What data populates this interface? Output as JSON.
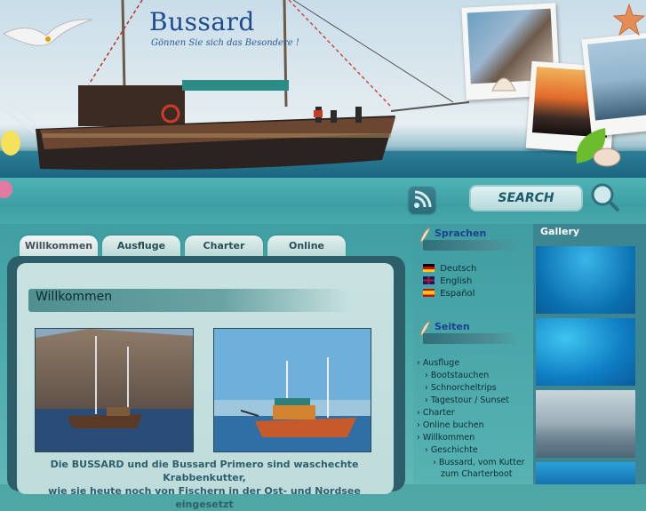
{
  "header": {
    "brand": "Bussard",
    "tagline": "Gönnen Sie sich das Besondere !"
  },
  "search": {
    "button_label": "SEARCH"
  },
  "tabs": [
    {
      "label": "Willkommen",
      "active": true
    },
    {
      "label": "Ausfluge",
      "active": false
    },
    {
      "label": "Charter",
      "active": false
    },
    {
      "label": "Online buchen",
      "active": false
    }
  ],
  "content": {
    "heading": "Willkommen",
    "intro_line1": "Die BUSSARD und die Bussard Primero sind waschechte Krabbenkutter,",
    "intro_line2": "wie sie heute noch von Fischern in der Ost- und Nordsee eingesetzt"
  },
  "sidebar": {
    "languages_title": "Sprachen",
    "languages": [
      {
        "label": "Deutsch",
        "flag": "de"
      },
      {
        "label": "English",
        "flag": "gb"
      },
      {
        "label": "Español",
        "flag": "es"
      }
    ],
    "pages_title": "Seiten",
    "pages": [
      {
        "label": "Ausfluge",
        "level": 0
      },
      {
        "label": "Bootstauchen",
        "level": 1
      },
      {
        "label": "Schnorcheltrips",
        "level": 1
      },
      {
        "label": "Tagestour / Sunset",
        "level": 1
      },
      {
        "label": "Charter",
        "level": 0
      },
      {
        "label": "Online buchen",
        "level": 0
      },
      {
        "label": "Willkommen",
        "level": 0
      },
      {
        "label": "Geschichte",
        "level": 1
      },
      {
        "label": "Bussard, vom Kutter",
        "level": 2
      },
      {
        "label": "zum Charterboot",
        "level": 2
      }
    ]
  },
  "gallery": {
    "title": "Gallery"
  },
  "colors": {
    "brand": "#1d4b8f",
    "teal": "#4ea7a5",
    "link_title": "#1f3f8f"
  }
}
